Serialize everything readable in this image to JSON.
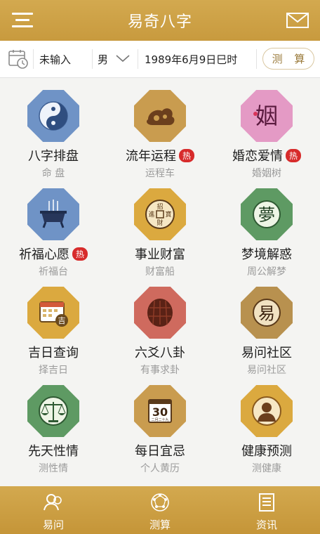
{
  "header": {
    "title": "易奇八字",
    "menu_icon": "hamburger-icon",
    "mail_icon": "mail-icon"
  },
  "input_bar": {
    "name_value": "未输入",
    "gender_value": "男",
    "birth_value": "1989年6月9日巳时",
    "submit_label": "测 算"
  },
  "grid": [
    {
      "title": "八字排盘",
      "sub": "命 盘",
      "hot": "",
      "icon": "yin-yang-icon",
      "color": "#6f93c6"
    },
    {
      "title": "流年运程",
      "sub": "运程车",
      "hot": "热",
      "icon": "cloud-dragon-icon",
      "color": "#c99c4f"
    },
    {
      "title": "婚恋爱情",
      "sub": "婚姻树",
      "hot": "热",
      "icon": "marriage-glyph-icon",
      "color": "#e49ac5"
    },
    {
      "title": "祈福心愿",
      "sub": "祈福台",
      "hot": "热",
      "icon": "incense-burner-icon",
      "color": "#6f93c6"
    },
    {
      "title": "事业财富",
      "sub": "财富船",
      "hot": "",
      "icon": "wealth-coin-icon",
      "color": "#dba93f"
    },
    {
      "title": "梦境解惑",
      "sub": "周公解梦",
      "hot": "",
      "icon": "dream-glyph-icon",
      "color": "#5e9a63"
    },
    {
      "title": "吉日查询",
      "sub": "择吉日",
      "hot": "",
      "icon": "calendar-icon",
      "color": "#dba93f"
    },
    {
      "title": "六爻八卦",
      "sub": "有事求卦",
      "hot": "",
      "icon": "tortoise-shell-icon",
      "color": "#cf6a5e"
    },
    {
      "title": "易问社区",
      "sub": "易问社区",
      "hot": "",
      "icon": "yi-glyph-icon",
      "color": "#b8914f"
    },
    {
      "title": "先天性情",
      "sub": "测性情",
      "hot": "",
      "icon": "scales-icon",
      "color": "#5e9a63"
    },
    {
      "title": "每日宜忌",
      "sub": "个人黄历",
      "hot": "",
      "icon": "daily-calendar-icon",
      "color": "#c99c4f"
    },
    {
      "title": "健康预测",
      "sub": "测健康",
      "hot": "",
      "icon": "person-bust-icon",
      "color": "#dba93f"
    }
  ],
  "bottom_tabs": [
    {
      "label": "易问",
      "icon": "chat-people-icon"
    },
    {
      "label": "测算",
      "icon": "bagua-icon",
      "active": true
    },
    {
      "label": "资讯",
      "icon": "news-icon"
    }
  ],
  "glyphs": {
    "marriage": "姻",
    "dream": "夢",
    "yi": "易",
    "calendar_day": "30",
    "calendar_sub": "二月二十九",
    "wealth": [
      "招",
      "進",
      "寶",
      "財"
    ],
    "calendar_ji": "吉"
  }
}
